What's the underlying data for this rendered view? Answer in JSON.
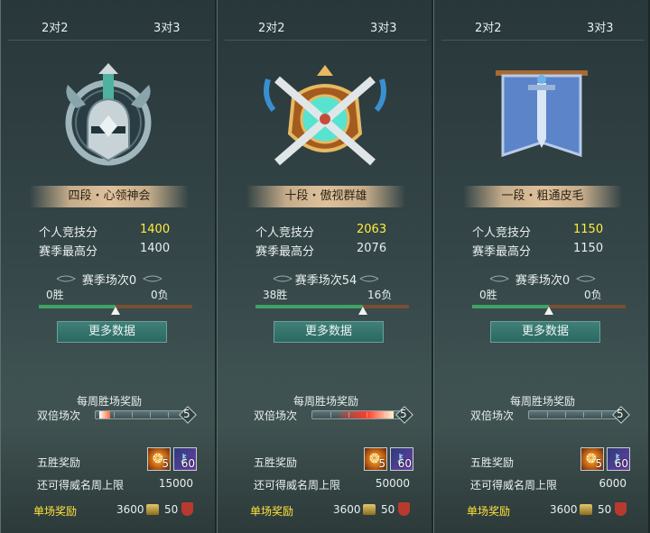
{
  "tabs": {
    "duo": "2对2",
    "trio": "3对3"
  },
  "labels": {
    "personal_score": "个人竞技分",
    "season_best": "赛季最高分",
    "more_data": "更多数据",
    "weekly_reward": "每周胜场奖励",
    "double_matches": "双倍场次",
    "five_win_reward": "五胜奖励",
    "fame_cap": "还可得威名周上限",
    "single_reward": "单场奖励"
  },
  "panels": [
    {
      "rank": "四段・心领神会",
      "personal_score": "1400",
      "season_best": "1400",
      "season_matches": "赛季场次0",
      "wins": "0胜",
      "losses": "0负",
      "win_ratio": 0.5,
      "double_count": "5",
      "item_a_count": "5",
      "item_b_count": "60",
      "fame_cap_value": "15000",
      "single_coin": "3600",
      "single_shield": "50"
    },
    {
      "rank": "十段・傲视群雄",
      "personal_score": "2063",
      "season_best": "2076",
      "season_matches": "赛季场次54",
      "wins": "38胜",
      "losses": "16负",
      "win_ratio": 0.7,
      "double_count": "5",
      "item_a_count": "5",
      "item_b_count": "60",
      "fame_cap_value": "50000",
      "single_coin": "3600",
      "single_shield": "50"
    },
    {
      "rank": "一段・粗通皮毛",
      "personal_score": "1150",
      "season_best": "1150",
      "season_matches": "赛季场次0",
      "wins": "0胜",
      "losses": "0负",
      "win_ratio": 0.5,
      "double_count": "5",
      "item_a_count": "5",
      "item_b_count": "60",
      "fame_cap_value": "6000",
      "single_coin": "3600",
      "single_shield": "50"
    }
  ],
  "colors": {
    "highlight_score": "#ffee3a",
    "single_reward": "#ffe23a",
    "win_bar": "#3ea364",
    "loss_bar": "#7a4e33",
    "button": "#2c6862"
  },
  "icons": {
    "rank4": "silver-helmet-emblem-icon",
    "rank10": "gold-crossed-swords-emblem-icon",
    "rank1": "blue-banner-sword-emblem-icon",
    "item_a": "fire-scroll-icon",
    "item_b": "blue-key-icon",
    "coin": "coin-icon",
    "shield": "shield-icon"
  }
}
